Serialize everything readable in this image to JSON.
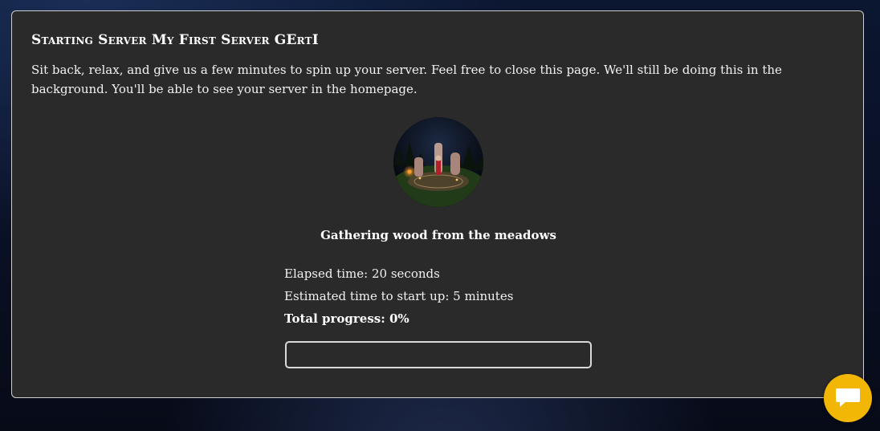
{
  "panel": {
    "title": "Starting Server My First Server GErtI",
    "description": "Sit back, relax, and give us a few minutes to spin up your server. Feel free to close this page. We'll still be doing this in the background. You'll be able to see your server in the homepage.",
    "status_message": "Gathering wood from the meadows",
    "elapsed_time": "Elapsed time: 20 seconds",
    "estimated_time": "Estimated time to start up: 5 minutes",
    "total_progress": "Total progress: 0%",
    "progress_fraction": 0
  },
  "icons": {
    "avatar": "campfire-scene-image",
    "chat": "chat-bubble-icon"
  },
  "colors": {
    "panel_background": "#2a2a2a",
    "chat_button": "#f2b705"
  }
}
